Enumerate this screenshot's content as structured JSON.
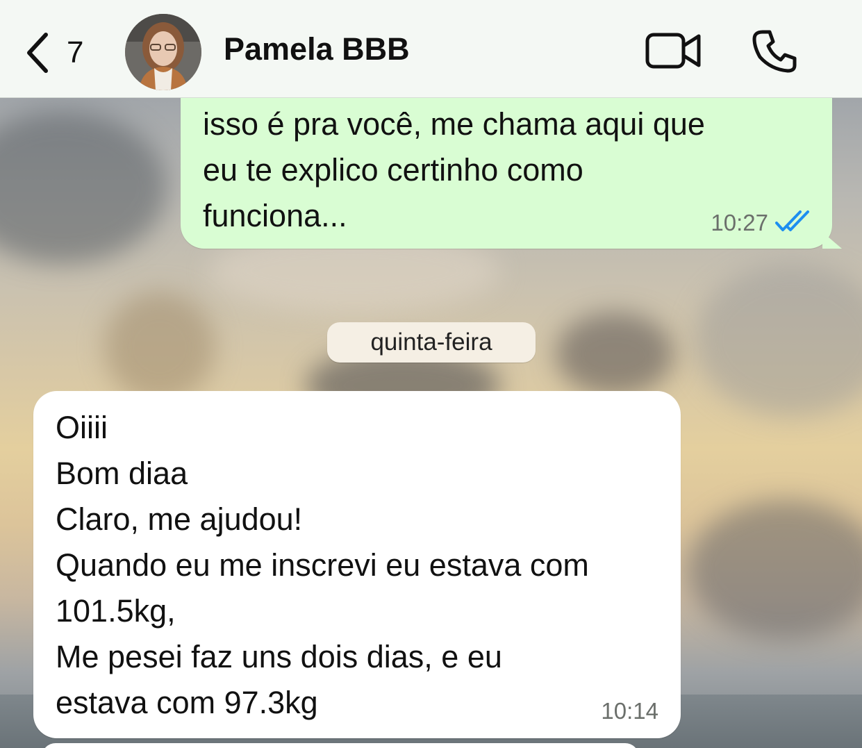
{
  "header": {
    "unread_count": "7",
    "contact_name": "Pamela BBB"
  },
  "messages": [
    {
      "direction": "outgoing",
      "lines": [
        "isso é pra você, me chama aqui que",
        "eu te explico certinho como",
        "funciona..."
      ],
      "time": "10:27",
      "status": "read"
    },
    {
      "direction": "separator",
      "text": "quinta-feira"
    },
    {
      "direction": "incoming",
      "lines": [
        "Oiiii",
        "Bom diaa",
        "Claro, me ajudou!",
        "Quando eu me inscrevi eu estava com",
        "101.5kg,",
        "Me pesei faz uns dois dias, e eu",
        "estava com 97.3kg"
      ],
      "time": "10:14"
    }
  ],
  "colors": {
    "outgoing_bubble": "#d9fdd3",
    "incoming_bubble": "#ffffff",
    "read_ticks": "#1d8ef0",
    "date_badge": "#f5efe4"
  },
  "icons": {
    "back": "chevron-left-icon",
    "video": "video-camera-icon",
    "call": "phone-icon",
    "read_receipt": "double-check-icon"
  }
}
